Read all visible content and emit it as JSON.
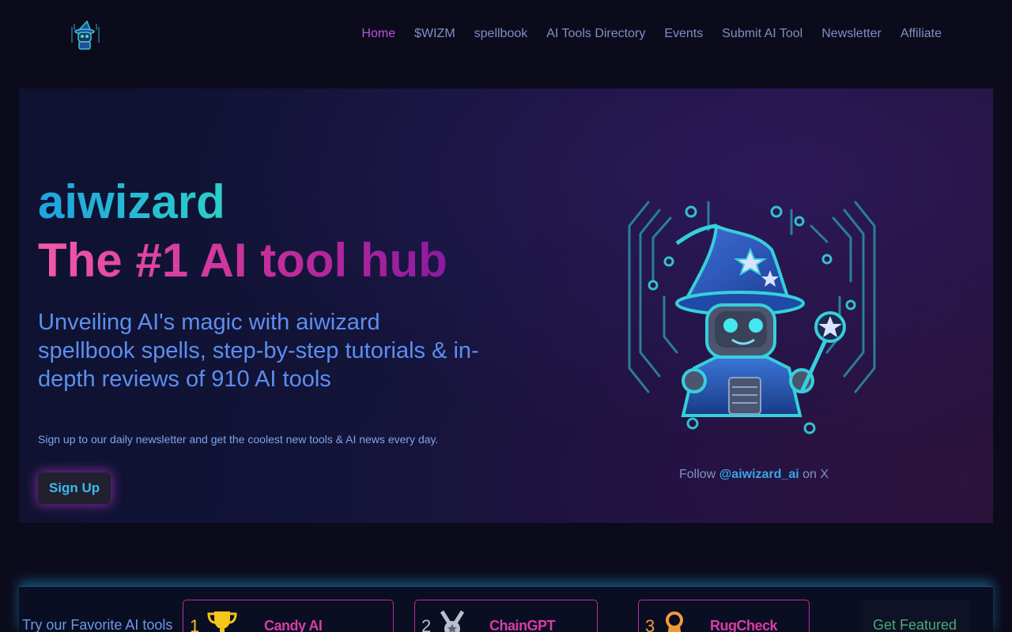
{
  "nav": {
    "links": [
      "Home",
      "$WIZM",
      "spellbook",
      "AI Tools Directory",
      "Events",
      "Submit AI Tool",
      "Newsletter",
      "Affiliate"
    ],
    "active": "Home"
  },
  "hero": {
    "brand": "aiwizard",
    "headline": "The #1 AI tool hub",
    "subtitle": "Unveiling AI's magic with aiwizard spellbook spells, step-by-step tutorials & in-depth reviews of 910 AI tools",
    "newsletter_text": "Sign up to our daily newsletter and get the coolest new tools & AI news every day.",
    "signup_label": "Sign Up",
    "follow_prefix": "Follow ",
    "follow_handle": "@aiwizard_ai",
    "follow_suffix": " on X"
  },
  "featured": {
    "label": "Try our Favorite AI tools",
    "tools": [
      {
        "rank": "1",
        "name": "Candy AI",
        "medal": "trophy-icon",
        "rank_color": "#f5c518"
      },
      {
        "rank": "2",
        "name": "ChainGPT",
        "medal": "silver-medal-icon",
        "rank_color": "#b9bfcc"
      },
      {
        "rank": "3",
        "name": "RugCheck",
        "medal": "bronze-medal-icon",
        "rank_color": "#f29a3a"
      }
    ],
    "cta": "Get Featured"
  },
  "colors": {
    "accent_pink": "#d93ca8",
    "accent_cyan": "#35a8e8",
    "nav_active": "#b455d6",
    "background": "#0c0b1c"
  }
}
